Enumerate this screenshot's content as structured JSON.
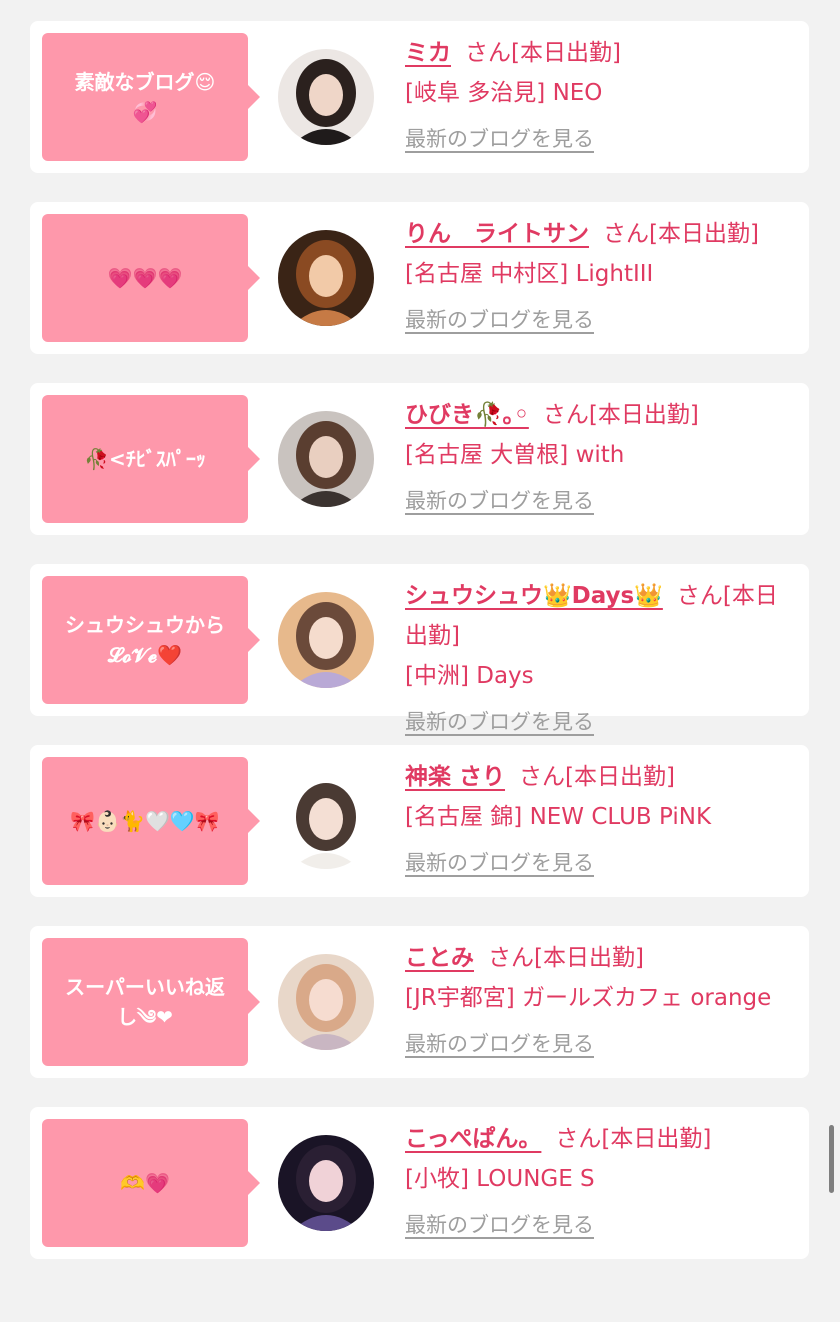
{
  "cards": [
    {
      "bubble": "素敵なブログ😌\n💞",
      "name": "ミカ",
      "suffix": "さん[本日出勤]",
      "shop": "[岐阜 多治見] NEO",
      "link": "最新のブログを見る",
      "avatar": {
        "bg": "#ece7e4",
        "hair": "#2b211e",
        "skin": "#efd6c8",
        "top": "#1f1b1b"
      }
    },
    {
      "bubble": "💗💗💗",
      "name": "りん　ライトサン",
      "suffix": "さん[本日出勤]",
      "shop": "[名古屋 中村区] LightIII",
      "link": "最新のブログを見る",
      "avatar": {
        "bg": "#3a2416",
        "hair": "#8a4a22",
        "skin": "#f2caa8",
        "top": "#c67a45"
      }
    },
    {
      "bubble": "🥀<ﾁﾋﾞｽﾊﾟｰｯ",
      "name": "ひびき🥀｡◦",
      "suffix": "さん[本日出勤]",
      "shop": "[名古屋 大曽根] with",
      "link": "最新のブログを見る",
      "avatar": {
        "bg": "#c9c3bf",
        "hair": "#5a3e30",
        "skin": "#e9cfc0",
        "top": "#3b3330"
      }
    },
    {
      "bubble": "シュウシュウから\n𝓛𝓸𝓥𝓮❤️",
      "name": "シュウシュウ👑Days👑",
      "suffix": "さん[本日出勤]",
      "shop": "[中洲] Days",
      "link": "最新のブログを見る",
      "avatar": {
        "bg": "#e7b98c",
        "hair": "#6b4a3a",
        "skin": "#f5dccd",
        "top": "#b9a9d6"
      }
    },
    {
      "bubble": "🎀👶🏻🐈🤍🩵🎀",
      "name": "神楽 さり",
      "suffix": "さん[本日出勤]",
      "shop": "[名古屋 錦] NEW CLUB PiNK",
      "link": "最新のブログを見る",
      "avatar": {
        "bg": "#ffffff",
        "hair": "#4a3a33",
        "skin": "#f4dfd4",
        "top": "#f1eeea"
      }
    },
    {
      "bubble": "スーパーいいね返\nし༄❤︎",
      "name": "ことみ",
      "suffix": "さん[本日出勤]",
      "shop": "[JR宇都宮] ガールズカフェ orange",
      "link": "最新のブログを見る",
      "avatar": {
        "bg": "#e8d7c9",
        "hair": "#d9a989",
        "skin": "#f6dcd0",
        "top": "#c9b6c2"
      }
    },
    {
      "bubble": "🫶💗",
      "name": "こっぺぱん。",
      "suffix": "さん[本日出勤]",
      "shop": "[小牧] LOUNGE S",
      "link": "最新のブログを見る",
      "avatar": {
        "bg": "#1a1426",
        "hair": "#2a1f33",
        "skin": "#f0d2d7",
        "top": "#5b4b8a"
      }
    }
  ]
}
